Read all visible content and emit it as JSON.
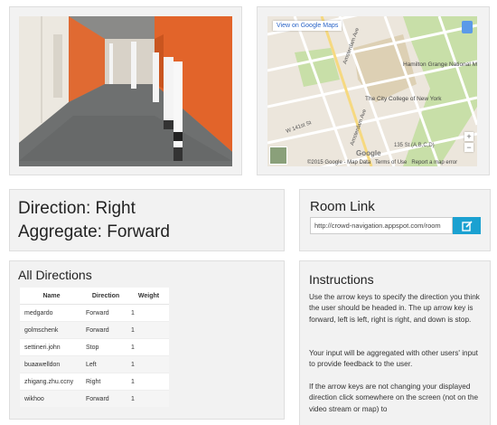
{
  "map": {
    "view_link": "View on Google Maps",
    "labels": {
      "memorial": "Hamilton Grange National Memorial",
      "college": "The City College of New York",
      "station": "135 St (A,B,C,D)",
      "amsterdam_1": "Amsterdam Ave",
      "amsterdam_2": "Amsterdam Ave",
      "street_1": "W 141st St"
    },
    "footer": {
      "copyright": "©2015 Google - Map Data",
      "terms": "Terms of Use",
      "report": "Report a map error"
    },
    "logo": "Google",
    "zoom_in": "+",
    "zoom_out": "−"
  },
  "status": {
    "direction_label": "Direction: Right",
    "aggregate_label": "Aggregate: Forward"
  },
  "room": {
    "title": "Room Link",
    "url": "http://crowd-navigation.appspot.com/room"
  },
  "directions": {
    "title": "All Directions",
    "columns": [
      "Name",
      "Direction",
      "Weight"
    ],
    "rows": [
      {
        "name": "medgardo",
        "direction": "Forward",
        "weight": "1"
      },
      {
        "name": "golmschenk",
        "direction": "Forward",
        "weight": "1"
      },
      {
        "name": "settineri.john",
        "direction": "Stop",
        "weight": "1"
      },
      {
        "name": "buaawelldon",
        "direction": "Left",
        "weight": "1"
      },
      {
        "name": "zhigang.zhu.ccny",
        "direction": "Right",
        "weight": "1"
      },
      {
        "name": "wikhoo",
        "direction": "Forward",
        "weight": "1"
      }
    ]
  },
  "instructions": {
    "title": "Instructions",
    "p1": "Use the arrow keys to specify the direction you think the user should be headed in. The up arrow key is forward, left is left, right is right, and down is stop.",
    "p2": "Your input will be aggregated with other users' input to provide feedback to the user.",
    "p3": "If the arrow keys are not changing your displayed direction click somewhere on the screen (not on the video stream or map) to"
  },
  "colors": {
    "accent": "#1ba1d1",
    "panel": "#f2f2f2",
    "wall": "#e2642a"
  }
}
